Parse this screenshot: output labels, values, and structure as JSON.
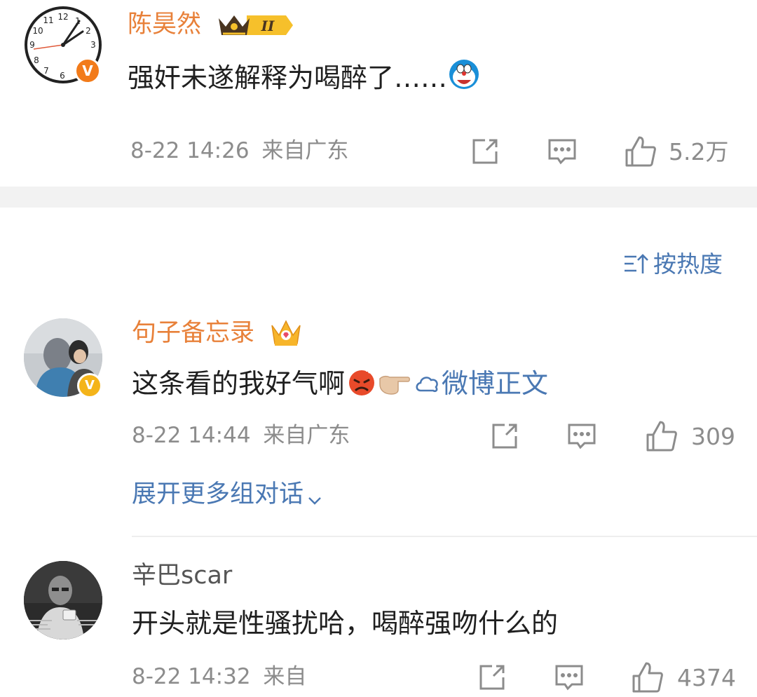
{
  "colors": {
    "vip_name": "#e8813a",
    "link": "#4a78b3",
    "meta": "#8c8c8c",
    "text": "#1f1f1f",
    "divider": "#eeeeee",
    "separator": "#f2f2f2",
    "badge_orange": "#f27b1a",
    "badge_gold": "#f4b41a"
  },
  "comments": [
    {
      "username": "陈昊然",
      "verified": true,
      "member_badge": "crown-level-badge",
      "level_text": "II",
      "text": "强奸未遂解释为喝醉了……",
      "emojis": [
        "doraemon-emoji"
      ],
      "time": "8-22 14:26",
      "location": "来自广东",
      "likes": "5.2万"
    },
    {
      "username": "句子备忘录",
      "verified": true,
      "member_badge": "crown-badge",
      "text": "这条看的我好气啊",
      "emojis": [
        "angry-face-emoji",
        "pointing-hand-emoji"
      ],
      "link_text": "微博正文",
      "time": "8-22 14:44",
      "location": "来自广东",
      "likes": "309",
      "expand_text": "展开更多组对话"
    },
    {
      "username": "辛巴scar",
      "verified": false,
      "text": "开头就是性骚扰哈，喝醉强吻什么的",
      "time": "8-22 14:32",
      "location": "来自",
      "likes": "4374"
    }
  ],
  "sort": {
    "label": "按热度",
    "icon": "sort-icon"
  }
}
